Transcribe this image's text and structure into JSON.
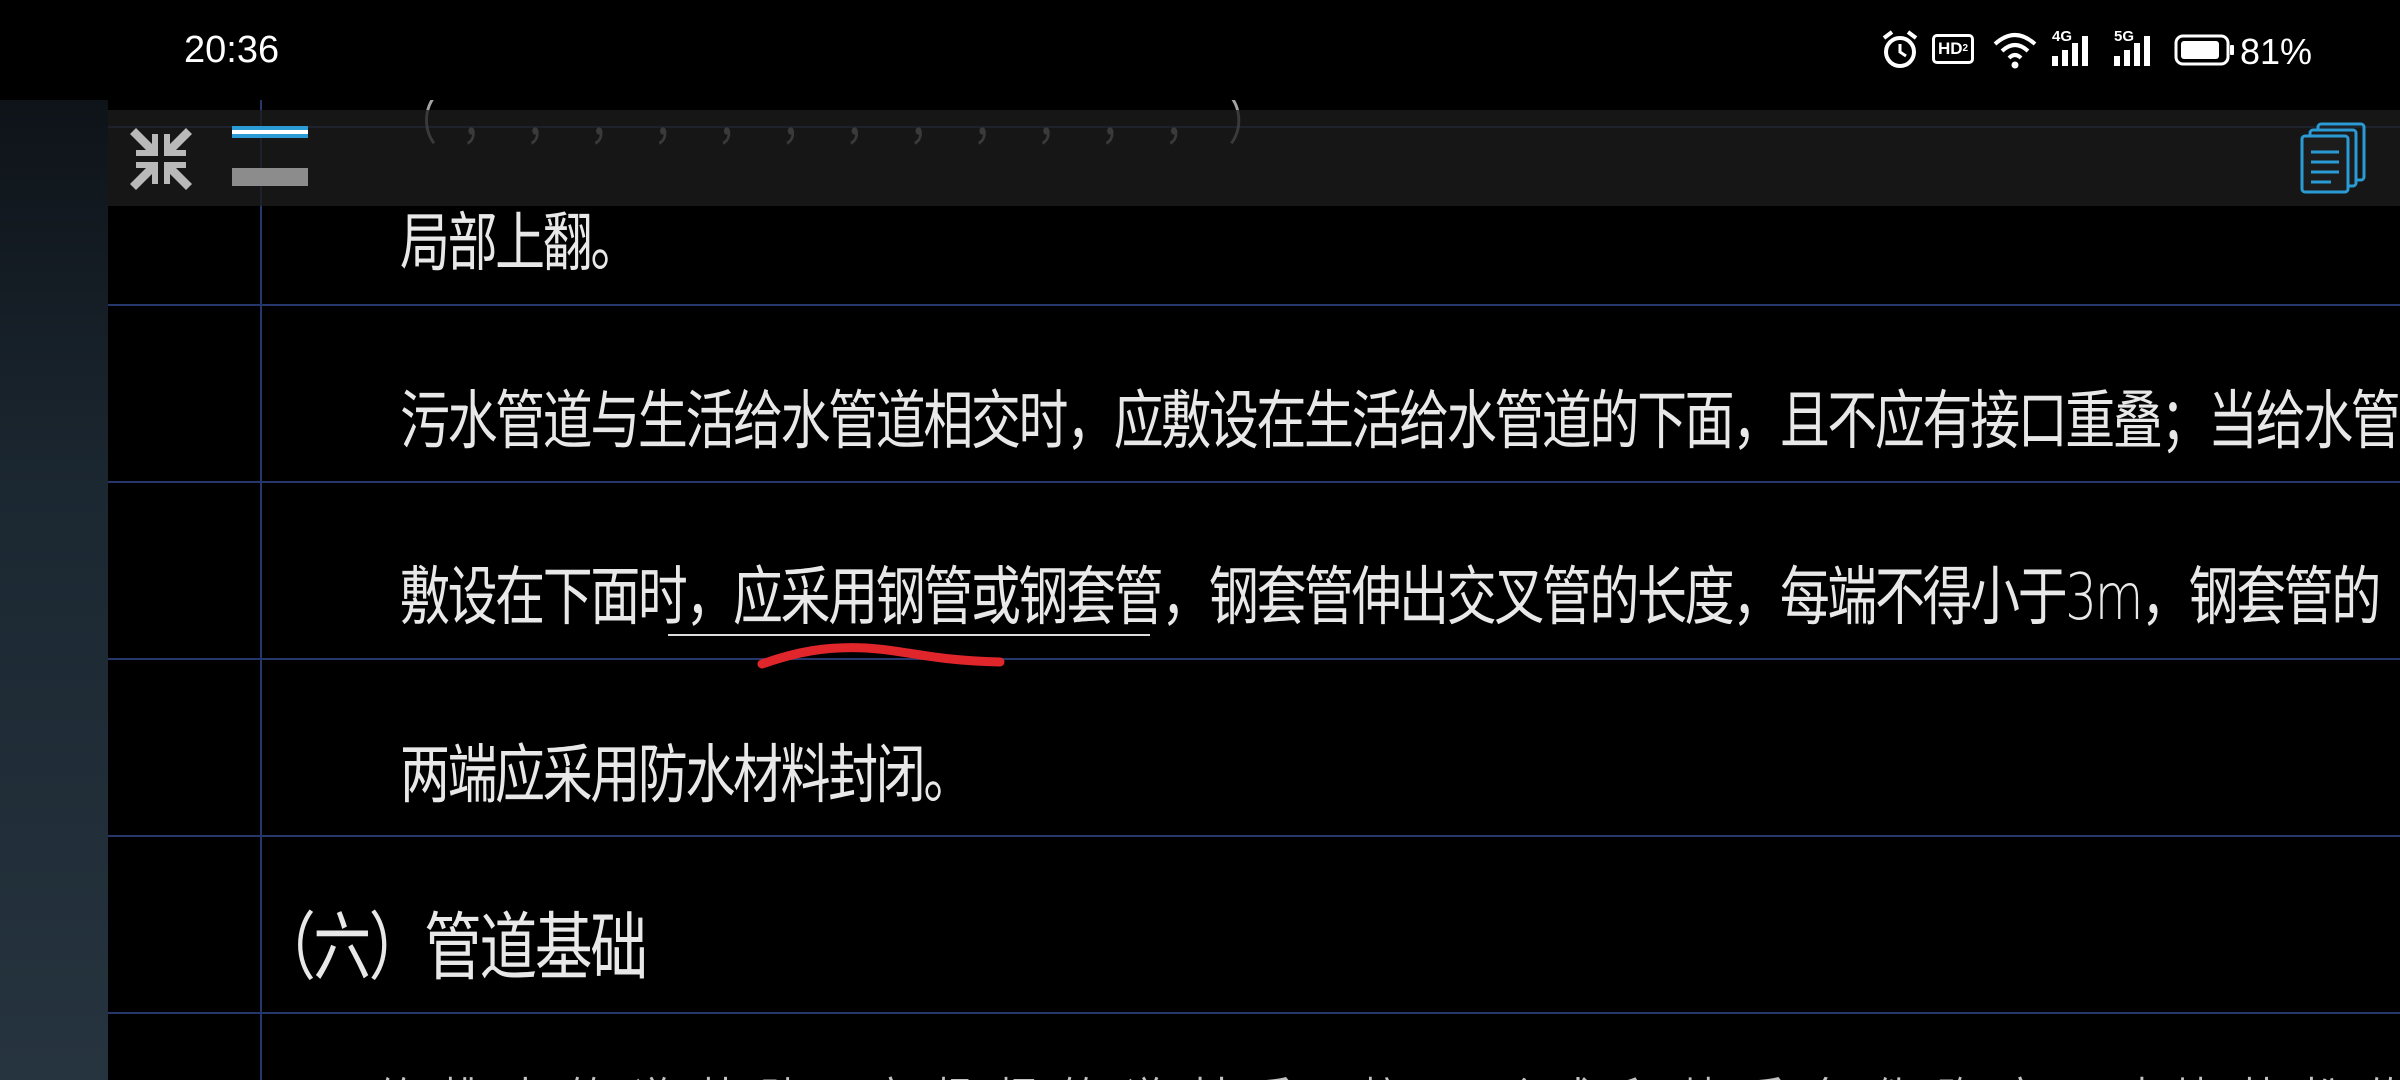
{
  "status_bar": {
    "time": "20:36",
    "hd_label": "HD",
    "hd_sub": "2",
    "net_1": "4G",
    "net_2": "5G",
    "battery": "81%"
  },
  "drawing": {
    "line_cut_top": "（ ，      ，    ，     ，    ，     ，         ，         ，    ， ， ，     ，  ）",
    "line_1": "局部上翻。",
    "line_2": "污水管道与生活给水管道相交时，应敷设在生活给水管道的下面，且不应有接口重叠；当给水管道",
    "line_3": "敷设在下面时，应采用钢管或钢套管，钢套管伸出交叉管的长度，每端不得小于3m，钢套管的",
    "line_4": "两端应采用防水材料封闭。",
    "heading": "（六）管道基础",
    "line_cut_bottom": "给 排 水 管 道 基 础 ，应 根 据 管 道 材 质 ，接 口 形 式 和 地 质 条 件 确 定 ，对 地 基 松 软 或 不 均 匀 沉 降"
  },
  "colors": {
    "grid": "#26376b",
    "markup": "#e0262b",
    "accent_blue": "#2a9bd4"
  },
  "icons": {
    "collapse": "collapse-arrows-icon",
    "layers": "layer-toggle-icon",
    "pages": "pages-stack-icon"
  }
}
